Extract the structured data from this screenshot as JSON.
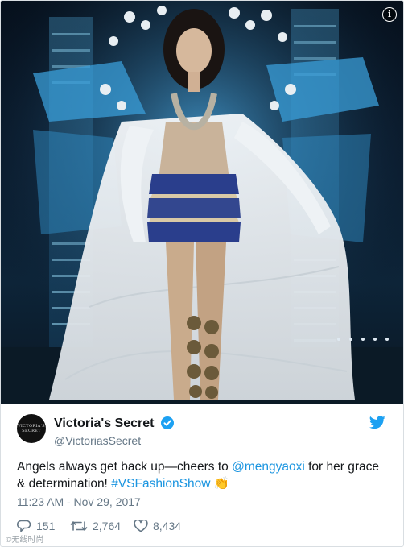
{
  "tweet": {
    "media_alt": "Runway model in white cape with blue bandeau, Victoria's Secret Fashion Show",
    "info_label": "i",
    "author": {
      "avatar_text": "VICTORIA'S SECRET",
      "name": "Victoria's Secret",
      "handle": "@VictoriasSecret",
      "verified": true
    },
    "text": {
      "part1": "Angels always get back up—cheers to ",
      "mention": "@mengyaoxi",
      "part2": " for her grace & determination! ",
      "hashtag": "#VSFashionShow",
      "emoji": "👏"
    },
    "timestamp": "11:23 AM - Nov 29, 2017",
    "stats": {
      "replies": "151",
      "retweets": "2,764",
      "likes": "8,434"
    },
    "watermark": "©无线时尚"
  },
  "colors": {
    "link": "#1b95e0",
    "muted": "#657786",
    "text": "#14171a",
    "twitter_blue": "#1da1f2",
    "media_bg": "#0a1a2c",
    "stage_blue": "#3a9ed8"
  }
}
